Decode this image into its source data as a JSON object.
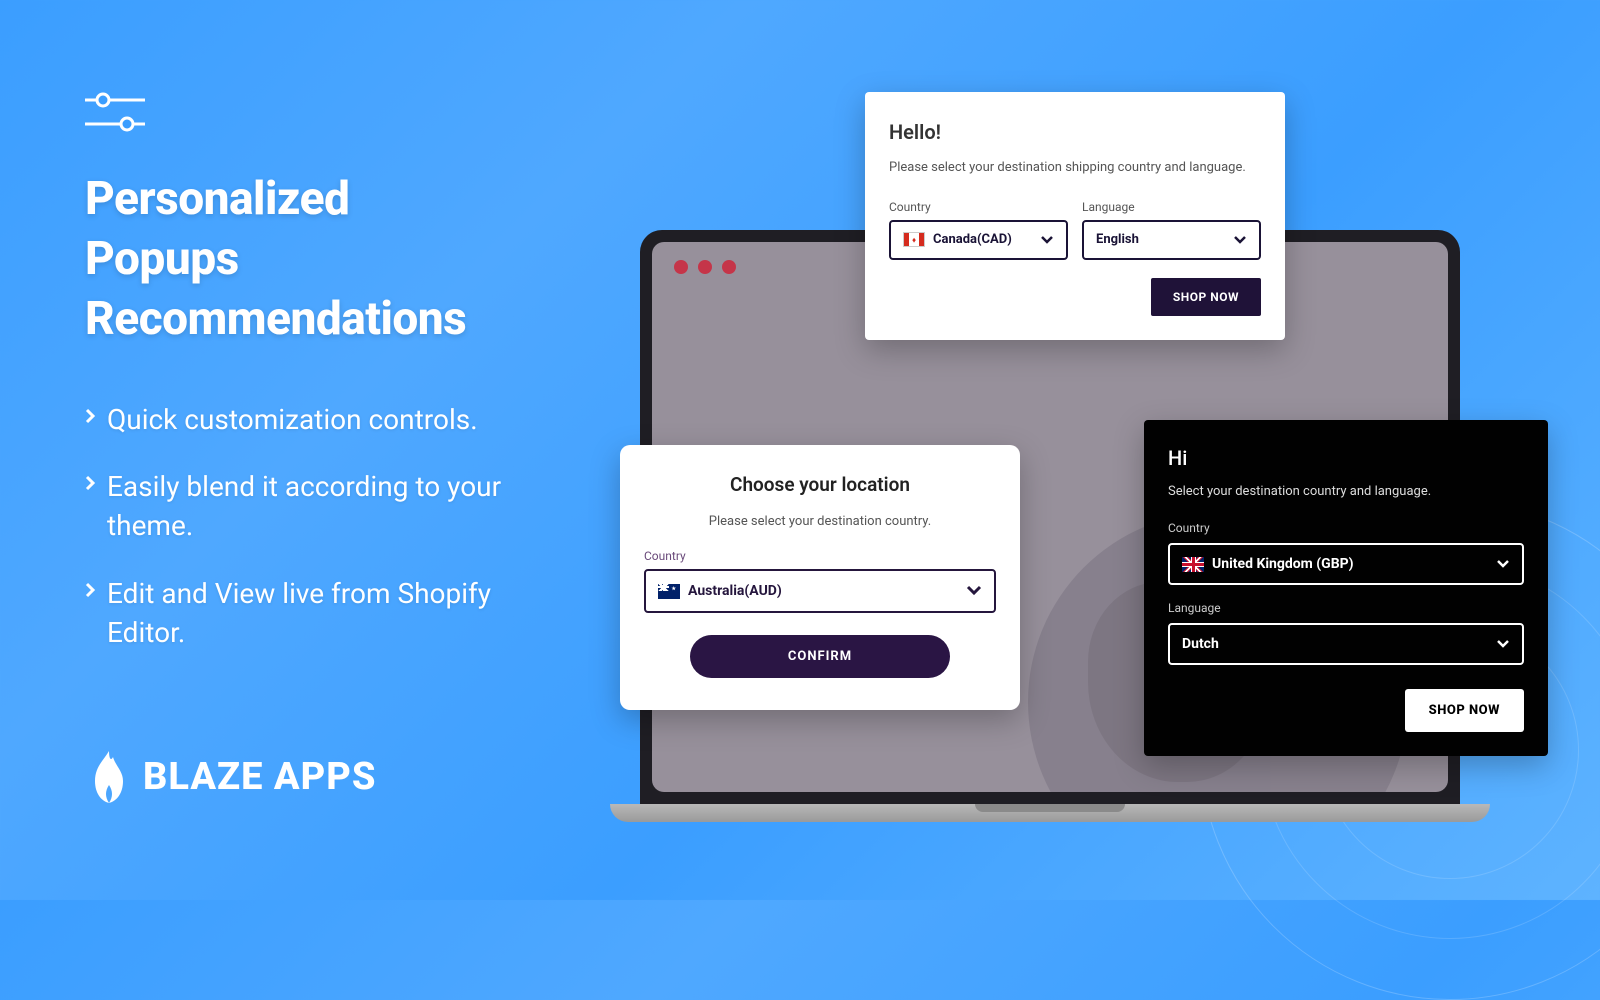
{
  "heading": {
    "line1": "Personalized",
    "line2": "Popups",
    "line3": "Recommendations"
  },
  "bullets": [
    "Quick customization controls.",
    "Easily blend it according to your theme.",
    "Edit and View live from Shopify Editor."
  ],
  "brand": "BLAZE APPS",
  "popup1": {
    "title": "Hello!",
    "subtitle": "Please select your destination shipping country and language.",
    "country_label": "Country",
    "country_value": "Canada(CAD)",
    "language_label": "Language",
    "language_value": "English",
    "button": "SHOP NOW"
  },
  "popup2": {
    "title": "Choose your location",
    "subtitle": "Please select your destination country.",
    "country_label": "Country",
    "country_value": "Australia(AUD)",
    "button": "CONFIRM"
  },
  "popup3": {
    "title": "Hi",
    "subtitle": "Select your destination country and language.",
    "country_label": "Country",
    "country_value": "United Kingdom (GBP)",
    "language_label": "Language",
    "language_value": "Dutch",
    "button": "SHOP NOW"
  }
}
